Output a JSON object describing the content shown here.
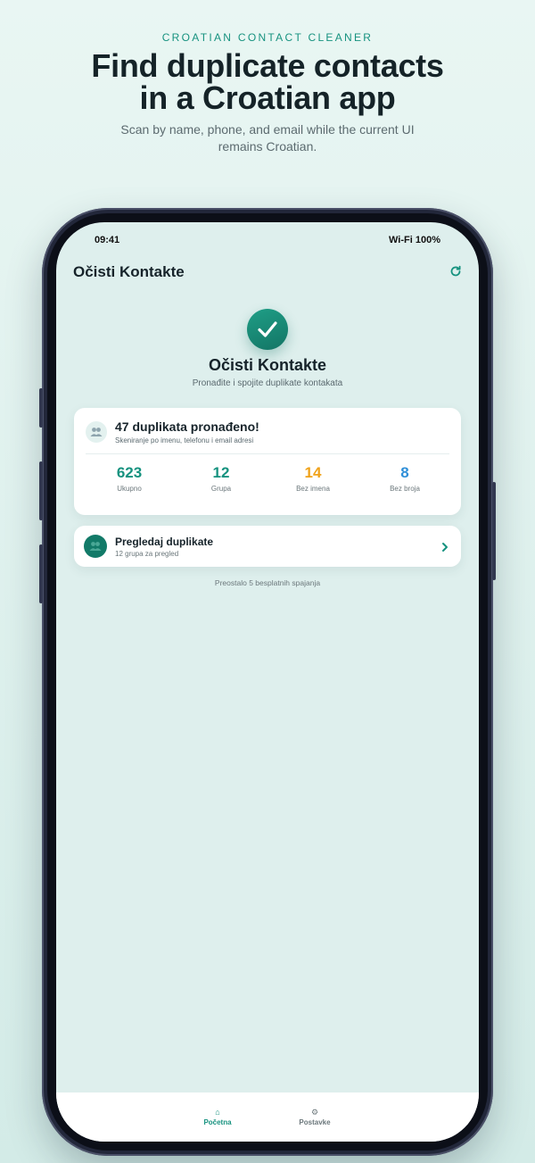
{
  "hero": {
    "eyebrow": "CROATIAN CONTACT CLEANER",
    "headline_line1": "Find duplicate contacts",
    "headline_line2": "in a Croatian app",
    "subline": "Scan by name, phone, and email while the current UI remains Croatian."
  },
  "status_bar": {
    "time": "09:41",
    "right": "Wi-Fi 100%"
  },
  "app_bar": {
    "title": "Očisti Kontakte",
    "refresh_icon": "refresh-icon"
  },
  "header": {
    "icon": "check-icon",
    "title": "Očisti Kontakte",
    "subtitle": "Pronađite i spojite duplikate kontakata"
  },
  "results": {
    "icon": "people-icon",
    "title": "47 duplikata pronađeno!",
    "subtitle": "Skeniranje po imenu, telefonu i email adresi",
    "stats": [
      {
        "value": "623",
        "label": "Ukupno",
        "color": "#16927f"
      },
      {
        "value": "12",
        "label": "Grupa",
        "color": "#16927f"
      },
      {
        "value": "14",
        "label": "Bez imena",
        "color": "#f0a21a"
      },
      {
        "value": "8",
        "label": "Bez broja",
        "color": "#2f8fd8"
      }
    ]
  },
  "review": {
    "icon": "people-icon",
    "title": "Pregledaj duplikate",
    "subtitle": "12 grupa za pregled",
    "chevron_icon": "chevron-right-icon"
  },
  "remaining_text": "Preostalo 5 besplatnih spajanja",
  "tab_bar": {
    "tabs": [
      {
        "label": "Početna",
        "icon": "⌂",
        "active": true
      },
      {
        "label": "Postavke",
        "icon": "⚙",
        "active": false
      }
    ]
  },
  "colors": {
    "accent": "#16927f",
    "screen_background": "#deefed",
    "orange": "#f0a21a",
    "blue": "#2f8fd8"
  }
}
